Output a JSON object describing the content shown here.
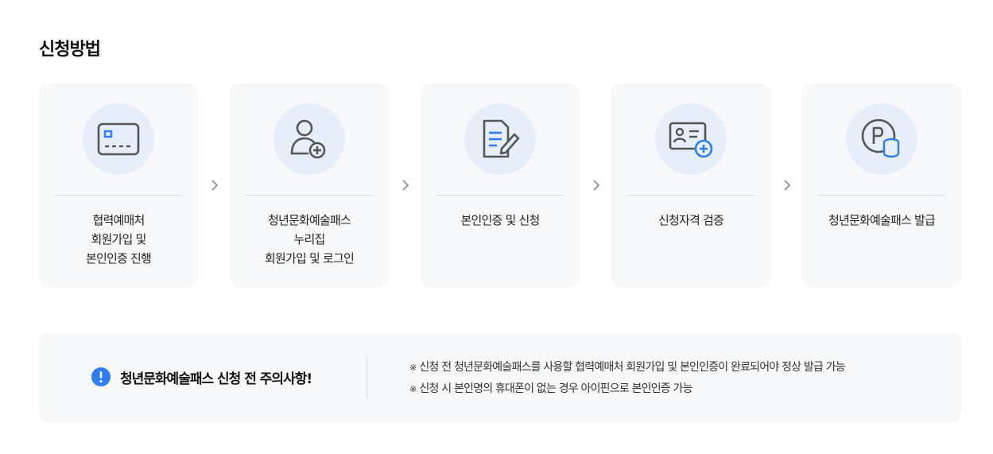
{
  "section": {
    "title": "신청방법"
  },
  "steps": [
    {
      "icon": "credit-card-icon",
      "label": "협력예매처\n회원가입 및\n본인인증 진행"
    },
    {
      "icon": "user-add-icon",
      "label": "청년문화예술패스\n누리집\n회원가입 및 로그인"
    },
    {
      "icon": "document-edit-icon",
      "label": "본인인증 및 신청"
    },
    {
      "icon": "id-card-add-icon",
      "label": "신청자격 검증"
    },
    {
      "icon": "points-coins-icon",
      "label": "청년문화예술패스 발급"
    }
  ],
  "notice": {
    "icon": "exclamation-circle-icon",
    "title": "청년문화예술패스 신청 전 주의사항!",
    "mark": "※",
    "items": [
      "신청 전 청년문화예술패스를 사용할 협력예매처 회원가입 및 본인인증이 완료되어야 정상 발급 가능",
      "신청 시 본인명의 휴대폰이 없는 경우 아이핀으로 본인인증 가능"
    ]
  },
  "colors": {
    "accent": "#2f7df6",
    "icon_stroke": "#555555",
    "icon_circle_bg": "#e6eefa",
    "card_bg": "#f7f8fa"
  }
}
